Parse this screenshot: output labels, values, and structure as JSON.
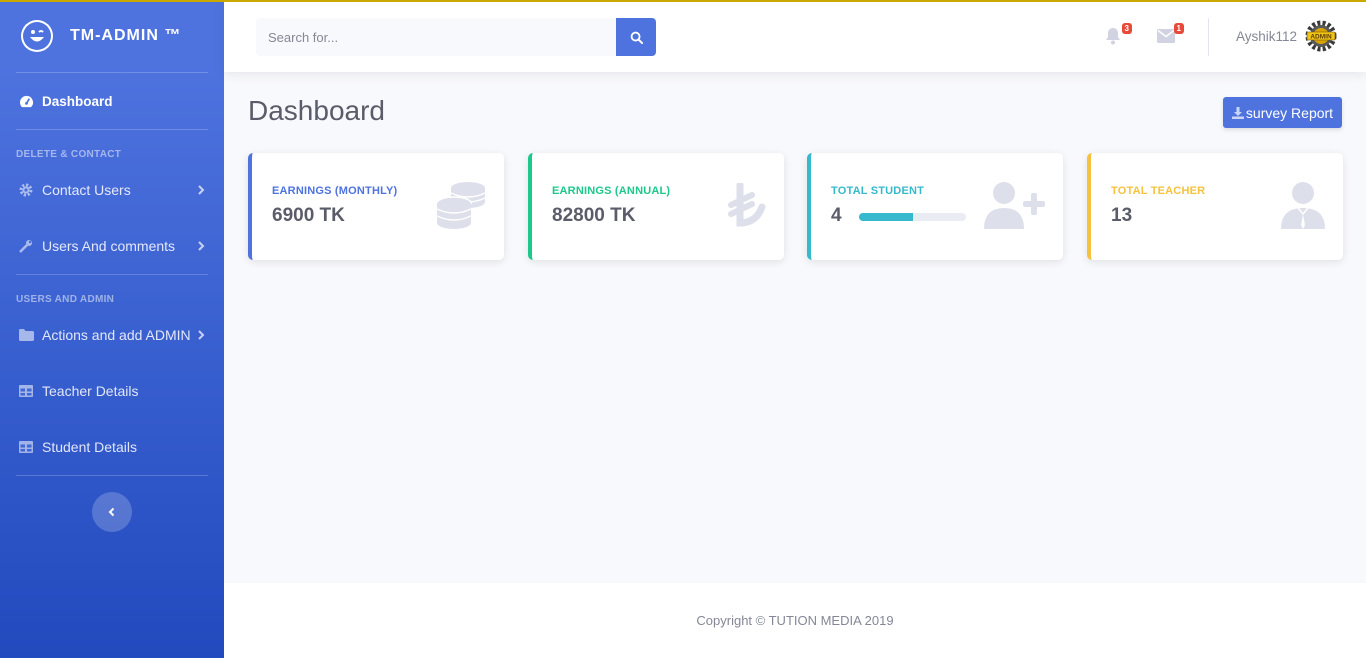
{
  "brand": {
    "name": "TM-ADMIN ™"
  },
  "sidebar": {
    "dashboard_label": "Dashboard",
    "heading_1": "DELETE & CONTACT",
    "items_1": [
      {
        "label": "Contact Users",
        "icon": "cog-icon"
      },
      {
        "label": "Users And comments",
        "icon": "wrench-icon"
      }
    ],
    "heading_2": "USERS AND ADMIN",
    "items_2": [
      {
        "label": "Actions and add ADMIN",
        "icon": "folder-icon"
      },
      {
        "label": "Teacher Details",
        "icon": "table-icon"
      },
      {
        "label": "Student Details",
        "icon": "table-icon"
      }
    ]
  },
  "topbar": {
    "search_placeholder": "Search for...",
    "alerts_count": "3",
    "messages_count": "1",
    "username": "Ayshik112",
    "avatar_text": "ADMIN"
  },
  "page": {
    "title": "Dashboard",
    "report_button": "survey Report"
  },
  "cards": [
    {
      "title": "EARNINGS (MONTHLY)",
      "value": "6900 TK",
      "color": "#4e73df",
      "icon": "coins-icon"
    },
    {
      "title": "EARNINGS (ANNUAL)",
      "value": "82800 TK",
      "color": "#1cc88a",
      "icon": "lira-icon"
    },
    {
      "title": "TOTAL STUDENT",
      "value": "4",
      "color": "#36b9cc",
      "icon": "user-plus-icon",
      "progress": 0.5
    },
    {
      "title": "TOTAL TEACHER",
      "value": "13",
      "color": "#f6c23e",
      "icon": "user-tie-icon"
    }
  ],
  "footer": {
    "text": "Copyright © TUTION MEDIA 2019"
  }
}
